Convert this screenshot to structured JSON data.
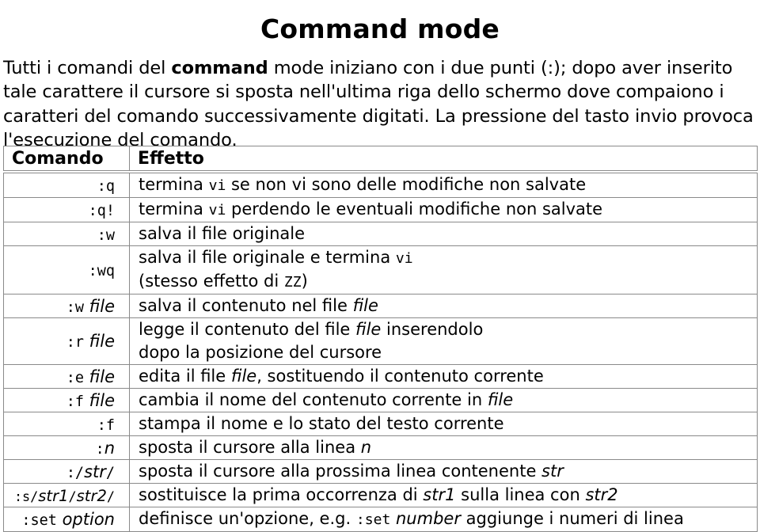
{
  "slide": {
    "title": "Command mode",
    "body_paragraph": "Tutti i comandi del command mode iniziano con i due punti (:); dopo aver inserito tale carattere il cursore si sposta nell'ultima riga dello schermo dove compaiono i caratteri del comando successivamente digitati. La pressione del tasto invio provoca l'esecuzione del comando.",
    "body_segments": [
      {
        "text": "Tutti i comandi del ",
        "style": "normal"
      },
      {
        "text": "command",
        "style": "bold"
      },
      {
        "text": " mode iniziano con i due punti (:); dopo aver inserito tale carattere il cursore si sposta nell'ultima riga dello schermo dove compaiono i caratteri del comando successivamente digitati.  La pressione del tasto invio provoca l'esecuzione del comando.",
        "style": "normal"
      }
    ]
  },
  "table": {
    "headers": {
      "command": "Comando",
      "effect": "Effetto"
    },
    "rows": [
      {
        "command_segments": [
          {
            "text": ":q",
            "style": "mono"
          }
        ],
        "effect_lines": [
          [
            {
              "text": "termina ",
              "style": "normal"
            },
            {
              "text": "vi",
              "style": "mono"
            },
            {
              "text": " se non vi sono delle modifiche non salvate",
              "style": "normal"
            }
          ]
        ]
      },
      {
        "command_segments": [
          {
            "text": ":q!",
            "style": "mono"
          }
        ],
        "effect_lines": [
          [
            {
              "text": "termina ",
              "style": "normal"
            },
            {
              "text": "vi",
              "style": "mono"
            },
            {
              "text": " perdendo le eventuali modifiche non salvate",
              "style": "normal"
            }
          ]
        ]
      },
      {
        "command_segments": [
          {
            "text": ":w",
            "style": "mono"
          }
        ],
        "effect_lines": [
          [
            {
              "text": "salva il file originale",
              "style": "normal"
            }
          ]
        ]
      },
      {
        "command_segments": [
          {
            "text": ":wq",
            "style": "mono"
          }
        ],
        "effect_lines": [
          [
            {
              "text": "salva il file originale e termina ",
              "style": "normal"
            },
            {
              "text": "vi",
              "style": "mono"
            }
          ],
          [
            {
              "text": "(stesso effetto di ",
              "style": "normal"
            },
            {
              "text": "ZZ",
              "style": "mono"
            },
            {
              "text": ")",
              "style": "normal"
            }
          ]
        ]
      },
      {
        "command_segments": [
          {
            "text": ":w",
            "style": "mono"
          },
          {
            "text": " file",
            "style": "italic"
          }
        ],
        "effect_lines": [
          [
            {
              "text": "salva il contenuto nel file ",
              "style": "normal"
            },
            {
              "text": "file",
              "style": "italic"
            }
          ]
        ]
      },
      {
        "command_segments": [
          {
            "text": ":r",
            "style": "mono"
          },
          {
            "text": " file",
            "style": "italic"
          }
        ],
        "effect_lines": [
          [
            {
              "text": "legge il contenuto del file ",
              "style": "normal"
            },
            {
              "text": "file",
              "style": "italic"
            },
            {
              "text": " inserendolo",
              "style": "normal"
            }
          ],
          [
            {
              "text": "dopo la posizione del cursore",
              "style": "normal"
            }
          ]
        ]
      },
      {
        "command_segments": [
          {
            "text": ":e",
            "style": "mono"
          },
          {
            "text": " file",
            "style": "italic"
          }
        ],
        "effect_lines": [
          [
            {
              "text": "edita il file ",
              "style": "normal"
            },
            {
              "text": "file",
              "style": "italic"
            },
            {
              "text": ", sostituendo il contenuto corrente",
              "style": "normal"
            }
          ]
        ]
      },
      {
        "command_segments": [
          {
            "text": ":f",
            "style": "mono"
          },
          {
            "text": " file",
            "style": "italic"
          }
        ],
        "effect_lines": [
          [
            {
              "text": "cambia il nome del contenuto corrente in ",
              "style": "normal"
            },
            {
              "text": "file",
              "style": "italic"
            }
          ]
        ]
      },
      {
        "command_segments": [
          {
            "text": ":f",
            "style": "mono"
          }
        ],
        "effect_lines": [
          [
            {
              "text": "stampa il nome e lo stato del testo corrente",
              "style": "normal"
            }
          ]
        ]
      },
      {
        "command_segments": [
          {
            "text": ":",
            "style": "mono"
          },
          {
            "text": "n",
            "style": "italic"
          }
        ],
        "effect_lines": [
          [
            {
              "text": "sposta il cursore alla linea ",
              "style": "normal"
            },
            {
              "text": "n",
              "style": "italic"
            }
          ]
        ]
      },
      {
        "command_segments": [
          {
            "text": ":/",
            "style": "mono"
          },
          {
            "text": "str",
            "style": "italic"
          },
          {
            "text": "/",
            "style": "mono"
          }
        ],
        "effect_lines": [
          [
            {
              "text": "sposta il cursore alla prossima linea contenente ",
              "style": "normal"
            },
            {
              "text": "str",
              "style": "italic"
            }
          ]
        ]
      },
      {
        "command_segments": [
          {
            "text": ":s/",
            "style": "mono"
          },
          {
            "text": "str1",
            "style": "italic"
          },
          {
            "text": "/",
            "style": "mono"
          },
          {
            "text": "str2",
            "style": "italic"
          },
          {
            "text": "/",
            "style": "mono"
          }
        ],
        "effect_lines": [
          [
            {
              "text": "sostituisce la prima occorrenza di ",
              "style": "normal"
            },
            {
              "text": "str1",
              "style": "italic"
            },
            {
              "text": " sulla linea con ",
              "style": "normal"
            },
            {
              "text": "str2",
              "style": "italic"
            }
          ]
        ]
      },
      {
        "command_segments": [
          {
            "text": ":set",
            "style": "mono"
          },
          {
            "text": " option",
            "style": "italic"
          }
        ],
        "effect_lines": [
          [
            {
              "text": "definisce un'opzione, e.g. ",
              "style": "normal"
            },
            {
              "text": ":set",
              "style": "mono"
            },
            {
              "text": " ",
              "style": "normal"
            },
            {
              "text": "number",
              "style": "italic"
            },
            {
              "text": " aggiunge i numeri di linea",
              "style": "normal"
            }
          ]
        ]
      }
    ]
  },
  "colors": {
    "background": "#ffffff",
    "text": "#000000",
    "table_border": "#8a8a8a"
  }
}
